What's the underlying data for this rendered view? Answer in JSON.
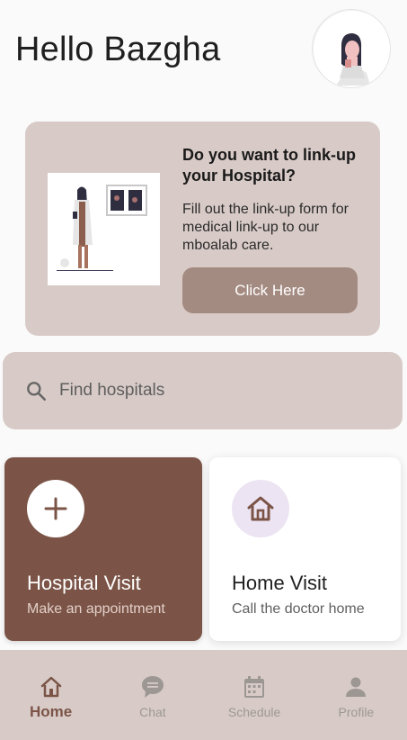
{
  "header": {
    "greeting": "Hello Bazgha"
  },
  "promo": {
    "title": "Do you want to link-up your Hospital?",
    "description": "Fill out the link-up form for medical link-up to our mboalab care.",
    "button_label": "Click Here"
  },
  "search": {
    "placeholder": "Find hospitals",
    "value": ""
  },
  "cards": [
    {
      "title": "Hospital Visit",
      "subtitle": "Make an appointment",
      "icon": "plus-icon"
    },
    {
      "title": "Home Visit",
      "subtitle": "Call the doctor home",
      "icon": "house-icon"
    }
  ],
  "nav": {
    "items": [
      {
        "label": "Home",
        "icon": "home-icon",
        "active": true
      },
      {
        "label": "Chat",
        "icon": "chat-icon",
        "active": false
      },
      {
        "label": "Schedule",
        "icon": "calendar-icon",
        "active": false
      },
      {
        "label": "Profile",
        "icon": "person-icon",
        "active": false
      }
    ]
  },
  "colors": {
    "accent": "#7b5447",
    "panel": "#d8cbc7",
    "button": "#a48b82",
    "inactive": "#9d9794"
  }
}
